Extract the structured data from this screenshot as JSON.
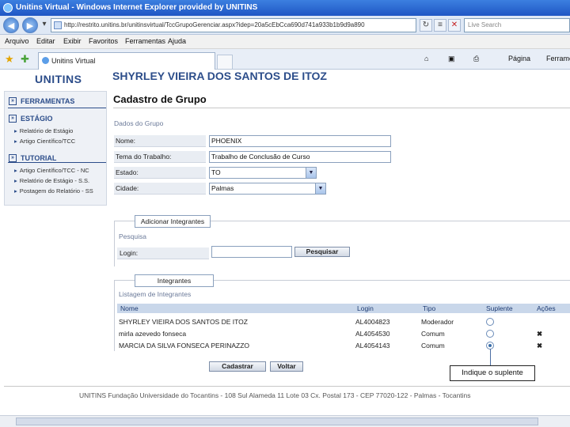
{
  "window": {
    "title": "Unitins Virtual - Windows Internet Explorer provided by UNITINS"
  },
  "browser": {
    "address": "http://restrito.unitins.br/unitinsvirtual/TccGrupoGerenciar.aspx?idep=20a5cEbCca690d741a933b1b9d9a890",
    "search_placeholder": "Live Search",
    "menu": [
      "Arquivo",
      "Editar",
      "Exibir",
      "Favoritos",
      "Ferramentas",
      "Ajuda"
    ],
    "tab_title": "Unitins Virtual",
    "tools": {
      "page": "Página",
      "tools": "Ferramentas"
    }
  },
  "header": {
    "logo": "UNITINS",
    "student_name": "SHYRLEY VIEIRA DOS SANTOS DE ITOZ"
  },
  "sidebar": {
    "tools_heading": "FERRAMENTAS",
    "stage_heading": "ESTÁGIO",
    "stage_items": [
      "Relatório de Estágio",
      "Artigo Científico/TCC"
    ],
    "tutorial_heading": "TUTORIAL",
    "tutorial_items": [
      "Artigo Científico/TCC - NC",
      "Relatório de Estágio - S.S.",
      "Postagem do Relatório - SS"
    ]
  },
  "form": {
    "title": "Cadastro de Grupo",
    "group_legend": "Dados do Grupo",
    "name_label": "Nome:",
    "name_value": "PHOENIX",
    "theme_label": "Tema do Trabalho:",
    "theme_value": "Trabalho de Conclusão de Curso",
    "state_label": "Estado:",
    "state_value": "TO",
    "city_label": "Cidade:",
    "city_value": "Palmas"
  },
  "add_members": {
    "tab_label": "Adicionar Integrantes",
    "search_legend": "Pesquisa",
    "login_label": "Login:",
    "search_button": "Pesquisar"
  },
  "members": {
    "tab_label": "Integrantes",
    "list_legend": "Listagem de Integrantes",
    "columns": {
      "name": "Nome",
      "login": "Login",
      "type": "Tipo",
      "substitute": "Suplente",
      "actions": "Ações"
    },
    "rows": [
      {
        "name": "SHYRLEY VIEIRA DOS SANTOS DE ITOZ",
        "login": "AL4004823",
        "type": "Moderador",
        "selected": false,
        "deletable": false
      },
      {
        "name": "mirla azevedo fonseca",
        "login": "AL4054530",
        "type": "Comum",
        "selected": false,
        "deletable": true
      },
      {
        "name": "MARCIA DA SILVA FONSECA PERINAZZO",
        "login": "AL4054143",
        "type": "Comum",
        "selected": true,
        "deletable": true
      }
    ]
  },
  "buttons": {
    "register": "Cadastrar",
    "back": "Voltar"
  },
  "tooltip": "Indique o suplente",
  "footer": "UNITINS  Fundação Universidade do Tocantins - 108 Sul Alameda 11 Lote 03 Cx. Postal 173 - CEP 77020-122 - Palmas - Tocantins",
  "colors": {
    "accent": "#2c4d8a",
    "delete": "#d01a1a",
    "header_row": "#c9d7ea"
  }
}
